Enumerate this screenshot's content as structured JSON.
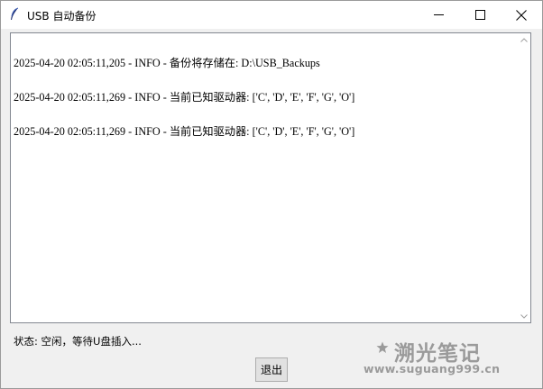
{
  "window": {
    "title": "USB 自动备份",
    "icon": "feather-icon"
  },
  "log": {
    "lines": [
      "2025-04-20 02:05:11,205 - INFO - 备份将存储在: D:\\USB_Backups",
      "2025-04-20 02:05:11,269 - INFO - 当前已知驱动器: ['C', 'D', 'E', 'F', 'G', 'O']",
      "2025-04-20 02:05:11,269 - INFO - 当前已知驱动器: ['C', 'D', 'E', 'F', 'G', 'O']"
    ]
  },
  "status": {
    "text": "状态: 空闲，等待U盘插入..."
  },
  "buttons": {
    "exit_label": "退出"
  },
  "watermark": {
    "title": "溯光笔记",
    "url": "www.suguang999.cn"
  }
}
